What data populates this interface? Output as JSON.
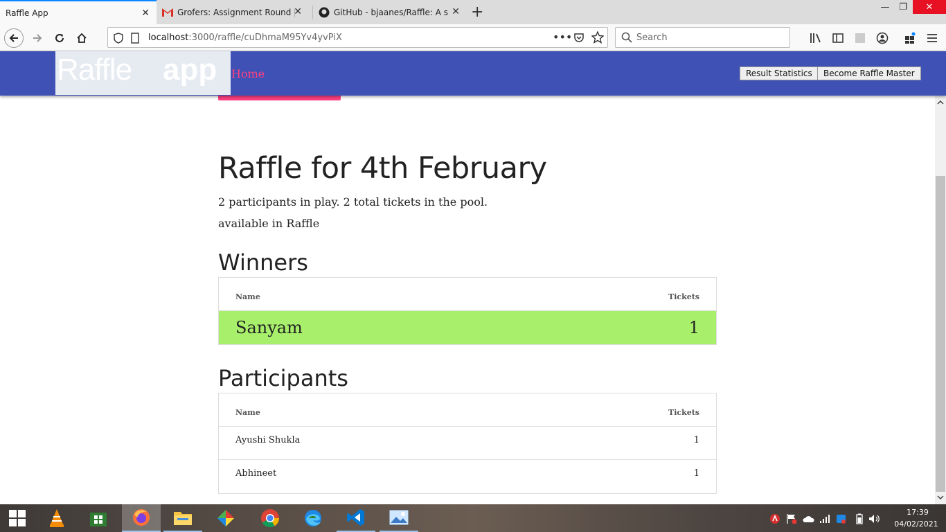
{
  "browser": {
    "tabs": [
      {
        "title": "Raffle App",
        "icon": "none"
      },
      {
        "title": "Grofers: Assignment Round | In",
        "icon": "gmail-icon"
      },
      {
        "title": "GitHub - bjaanes/Raffle: A simp",
        "icon": "github-icon"
      }
    ],
    "url_host": "localhost",
    "url_path": ":3000/raffle/cuDhmaM95Yv4yvPiX",
    "search_placeholder": "Search"
  },
  "app": {
    "logo_text_light": "Raffle",
    "logo_text_bold": "app",
    "nav_home": "Home",
    "btn_result_statistics": "Result Statistics",
    "btn_become_master": "Become Raffle Master",
    "colors": {
      "header": "#3f51b5",
      "accent": "#ff4081",
      "winner": "#a8f06b"
    }
  },
  "page": {
    "title": "Raffle for 4th February",
    "summary": "2 participants in play. 2 total tickets in the pool.",
    "availability": "available in Raffle",
    "winners": {
      "heading": "Winners",
      "col_name": "Name",
      "col_tickets": "Tickets",
      "rows": [
        {
          "name": "Sanyam",
          "tickets": "1"
        }
      ]
    },
    "participants": {
      "heading": "Participants",
      "col_name": "Name",
      "col_tickets": "Tickets",
      "rows": [
        {
          "name": "Ayushi Shukla",
          "tickets": "1"
        },
        {
          "name": "Abhineet",
          "tickets": "1"
        }
      ]
    }
  },
  "taskbar": {
    "time": "17:39",
    "date": "04/02/2021",
    "apps": [
      "vlc-icon",
      "store-icon",
      "firefox-icon",
      "file-explorer-icon",
      "snip-icon",
      "chrome-icon",
      "edge-icon",
      "vscode-icon",
      "photos-icon"
    ]
  }
}
